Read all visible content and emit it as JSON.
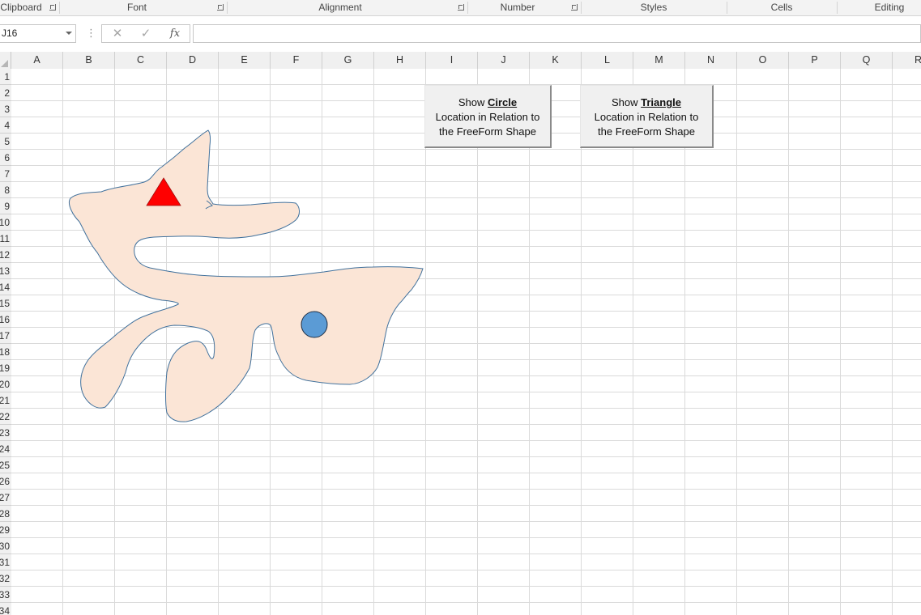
{
  "ribbon": {
    "groups": [
      "Clipboard",
      "Font",
      "Alignment",
      "Number",
      "Styles",
      "Cells",
      "Editing"
    ]
  },
  "formula_bar": {
    "name_box_value": "J16",
    "cancel_glyph": "✕",
    "enter_glyph": "✓",
    "fx_label": "fx",
    "formula_value": ""
  },
  "columns": [
    "A",
    "B",
    "C",
    "D",
    "E",
    "F",
    "G",
    "H",
    "I",
    "J",
    "K",
    "L",
    "M",
    "N",
    "O",
    "P",
    "Q",
    "R"
  ],
  "rows": [
    "1",
    "2",
    "3",
    "4",
    "5",
    "6",
    "7",
    "8",
    "9",
    "10",
    "11",
    "12",
    "13",
    "14",
    "15",
    "16",
    "17",
    "18",
    "19",
    "20",
    "21",
    "22",
    "23",
    "24",
    "25",
    "26",
    "27",
    "28",
    "29",
    "30",
    "31",
    "32",
    "33",
    "34"
  ],
  "buttons": {
    "circle": {
      "prefix": "Show ",
      "bold": "Circle",
      "line2": "Location in Relation to",
      "line3": "the FreeForm Shape"
    },
    "triangle": {
      "prefix": "Show ",
      "bold": "Triangle",
      "line2": "Location in Relation to",
      "line3": "the FreeForm Shape"
    }
  },
  "shapes": {
    "freeform_fill": "#fbe5d6",
    "freeform_stroke": "#41719c",
    "triangle_fill": "#ff0000",
    "circle_fill": "#5b9bd5"
  },
  "icons": [
    "dialog-launcher-icon",
    "dropdown-arrow-icon",
    "cancel-icon",
    "enter-icon",
    "function-icon",
    "select-all-icon"
  ]
}
